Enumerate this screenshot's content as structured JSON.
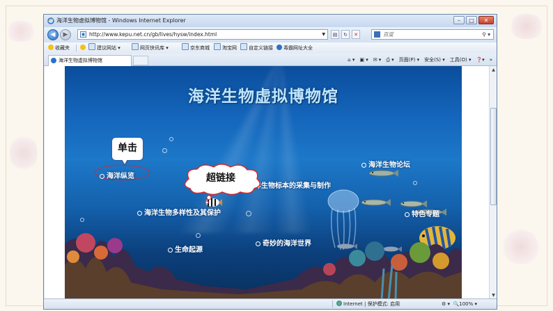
{
  "window": {
    "title": "海洋生物虚拟博物馆 - Windows Internet Explorer",
    "controls": {
      "minimize": "–",
      "maximize": "□",
      "close": "✕"
    }
  },
  "address": {
    "url": "http://www.kepu.net.cn/gb/lives/hysw/index.html",
    "search_placeholder": "百度"
  },
  "favorites": {
    "label": "收藏夹",
    "items": [
      "建议网站 ▾",
      "网页快讯库 ▾",
      "京东商城",
      "淘宝网",
      "自定义链接",
      "毒霸网址大全"
    ]
  },
  "tab": {
    "title": "海洋生物虚拟博物馆"
  },
  "commands": [
    "页面(P) ▾",
    "安全(S) ▾",
    "工具(O) ▾",
    "»"
  ],
  "site": {
    "title": "海洋生物虚拟博物馆",
    "links": {
      "ocean_overview": "海洋纵览",
      "specimen": "海洋生物标本的采集与制作",
      "forum": "海洋生物论坛",
      "diversity": "海洋生物多样性及其保护",
      "special": "特色专题",
      "origin": "生命起源",
      "wonder": "奇妙的海洋世界"
    },
    "callout_click": "单击",
    "callout_hyperlink": "超链接"
  },
  "status": {
    "zone": "Internet | 保护模式: 启用",
    "zoom": "100%"
  },
  "colors": {
    "ocean_top": "#0b4d9c",
    "ocean_bottom": "#08305d",
    "highlight_ring": "#d8282a",
    "callout_border": "#2a5ea8"
  }
}
